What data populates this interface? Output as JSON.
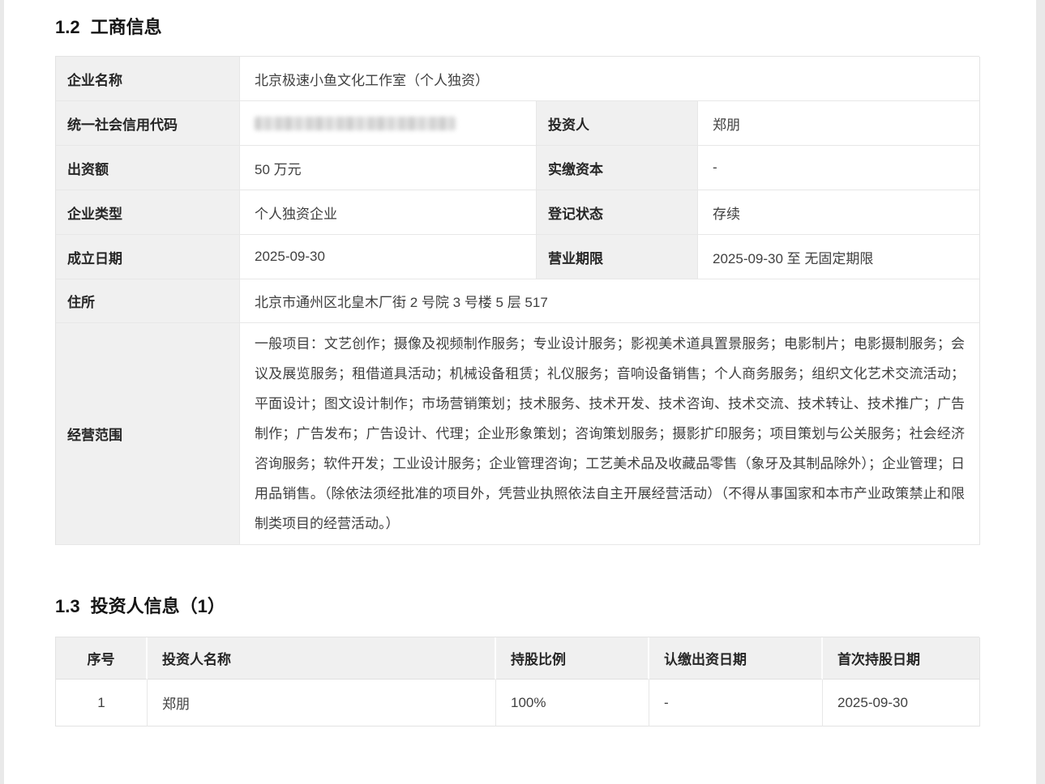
{
  "theme": {
    "page_background": "#e9e9e9",
    "card_background": "#ffffff",
    "label_cell_background": "#f0f0f0",
    "border_color": "#e3e3e3",
    "label_text_color": "#262626",
    "value_text_color": "#404040"
  },
  "business_info": {
    "heading": {
      "number": "1.2",
      "title": "工商信息"
    },
    "fields": {
      "name": {
        "label": "企业名称",
        "value": "北京极速小鱼文化工作室（个人独资）"
      },
      "credit_code": {
        "label": "统一社会信用代码",
        "redacted": true
      },
      "investor": {
        "label": "投资人",
        "value": "郑朋"
      },
      "capital": {
        "label": "出资额",
        "value": "50 万元"
      },
      "paid_in": {
        "label": "实缴资本",
        "value": "-"
      },
      "type": {
        "label": "企业类型",
        "value": "个人独资企业"
      },
      "status": {
        "label": "登记状态",
        "value": "存续"
      },
      "established": {
        "label": "成立日期",
        "value": "2025-09-30"
      },
      "term": {
        "label": "营业期限",
        "value": "2025-09-30 至 无固定期限"
      },
      "address": {
        "label": "住所",
        "value": "北京市通州区北皇木厂街 2 号院 3 号楼 5 层 517"
      },
      "scope": {
        "label": "经营范围",
        "value": "一般项目：文艺创作；摄像及视频制作服务；专业设计服务；影视美术道具置景服务；电影制片；电影摄制服务；会议及展览服务；租借道具活动；机械设备租赁；礼仪服务；音响设备销售；个人商务服务；组织文化艺术交流活动；平面设计；图文设计制作；市场营销策划；技术服务、技术开发、技术咨询、技术交流、技术转让、技术推广；广告制作；广告发布；广告设计、代理；企业形象策划；咨询策划服务；摄影扩印服务；项目策划与公关服务；社会经济咨询服务；软件开发；工业设计服务；企业管理咨询；工艺美术品及收藏品零售（象牙及其制品除外）；企业管理；日用品销售。（除依法须经批准的项目外，凭营业执照依法自主开展经营活动）（不得从事国家和本市产业政策禁止和限制类项目的经营活动。）"
      }
    }
  },
  "investor_info": {
    "heading": {
      "number": "1.3",
      "title": "投资人信息（1）"
    },
    "columns": [
      "序号",
      "投资人名称",
      "持股比例",
      "认缴出资日期",
      "首次持股日期"
    ],
    "rows": [
      {
        "index": "1",
        "name": "郑朋",
        "ratio": "100%",
        "subscribe_date": "-",
        "first_hold_date": "2025-09-30"
      }
    ]
  }
}
